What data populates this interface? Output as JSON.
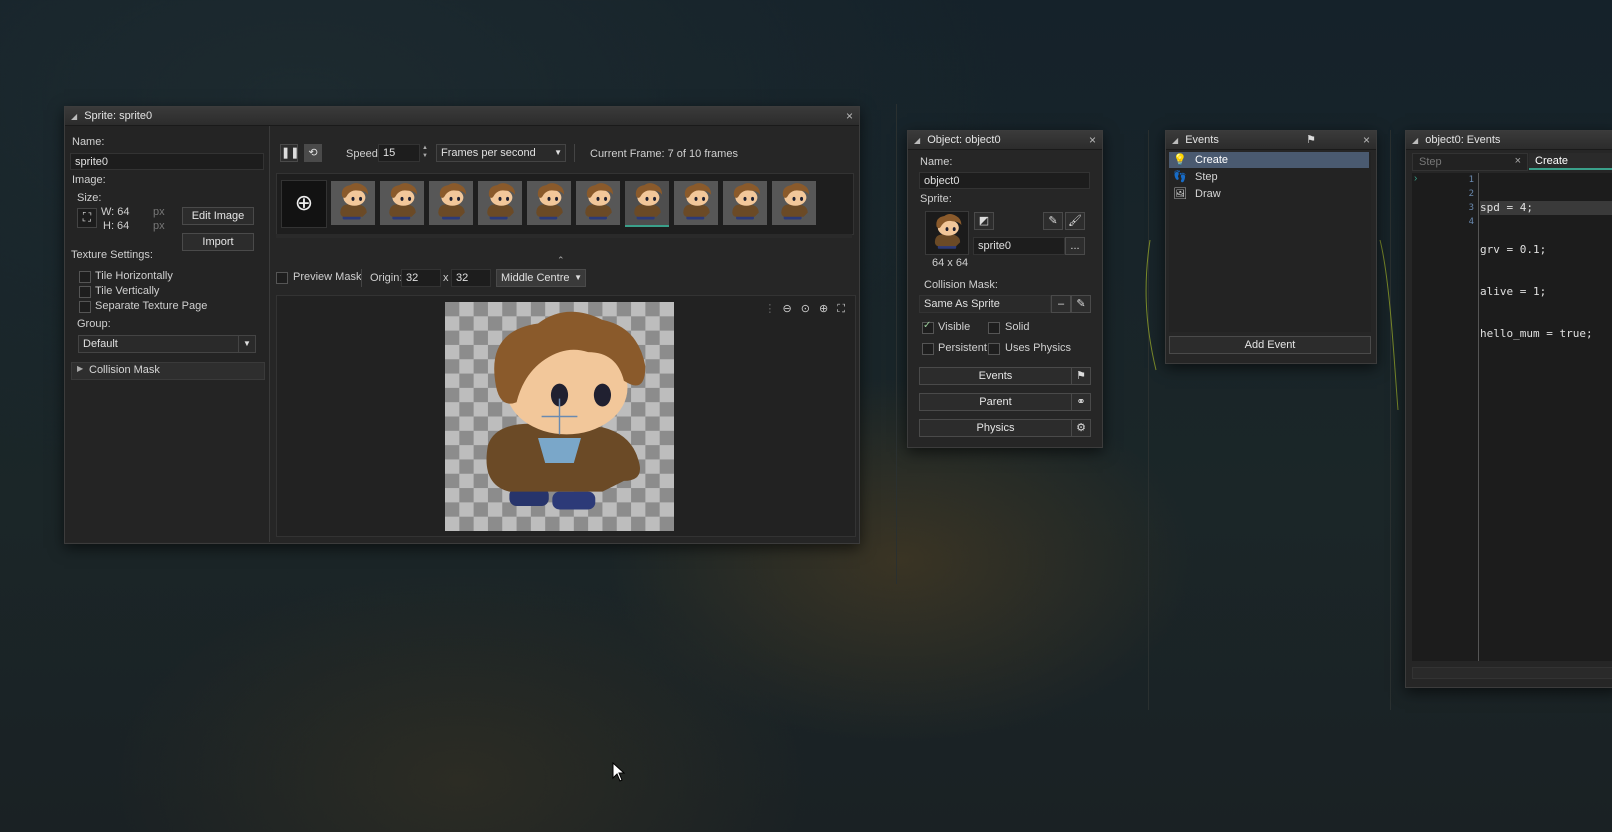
{
  "sprite_editor": {
    "title": "Sprite: sprite0",
    "name_label": "Name:",
    "name_value": "sprite0",
    "image_label": "Image:",
    "size_label": "Size:",
    "width": "W: 64",
    "height": "H: 64",
    "unit": "px",
    "edit_image_label": "Edit Image",
    "import_label": "Import",
    "texture_settings_label": "Texture Settings:",
    "tile_h_label": "Tile Horizontally",
    "tile_v_label": "Tile Vertically",
    "separate_label": "Separate Texture Page",
    "group_label": "Group:",
    "group_value": "Default",
    "collision_mask_label": "Collision Mask",
    "speed_label": "Speed:",
    "speed_value": "15",
    "speed_unit": "Frames per second",
    "current_frame": "Current Frame: 7 of 10 frames",
    "frame_count": 10,
    "selected_frame": 7,
    "preview_mask_label": "Preview Mask",
    "origin_label": "Origin:",
    "origin_x": "32",
    "origin_x_sep": "x",
    "origin_y": "32",
    "origin_preset": "Middle Centre"
  },
  "object_editor": {
    "title": "Object: object0",
    "name_label": "Name:",
    "name_value": "object0",
    "sprite_label": "Sprite:",
    "sprite_value": "sprite0",
    "sprite_dims": "64 x 64",
    "collision_label": "Collision Mask:",
    "collision_value": "Same As Sprite",
    "visible_label": "Visible",
    "solid_label": "Solid",
    "persistent_label": "Persistent",
    "physics_check_label": "Uses Physics",
    "events_btn": "Events",
    "parent_btn": "Parent",
    "physics_btn": "Physics",
    "browse_label": "...",
    "clear_label": "–"
  },
  "events_panel": {
    "title": "Events",
    "items": [
      "Create",
      "Step",
      "Draw"
    ],
    "add_event_label": "Add Event"
  },
  "code_editor": {
    "title": "object0: Events",
    "tabs": [
      "Step",
      "Create"
    ],
    "line_numbers": [
      "1",
      "2",
      "3",
      "4"
    ],
    "lines": [
      "spd = 4;",
      "grv = 0.1;",
      "alive = 1;",
      "hello_mum = true;"
    ]
  },
  "colors": {
    "accent": "#3aa08a",
    "selected": "#4a5a70",
    "code_number": "#e08a6a"
  }
}
